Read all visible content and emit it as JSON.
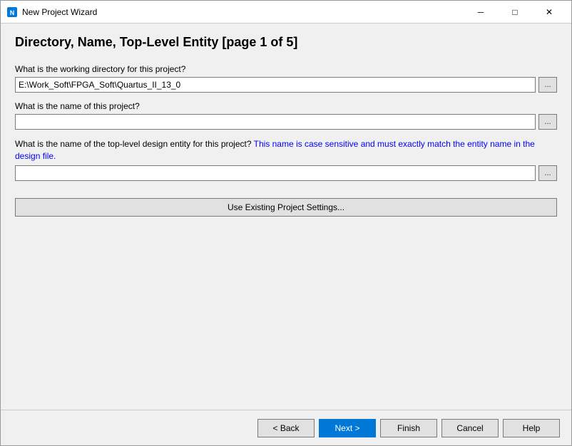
{
  "window": {
    "title": "New Project Wizard",
    "close_btn": "✕",
    "minimize_btn": "─",
    "maximize_btn": "□"
  },
  "page": {
    "title": "Directory, Name, Top-Level Entity [page 1 of 5]"
  },
  "form": {
    "working_dir_label": "What is the working directory for this project?",
    "working_dir_value": "E:\\Work_Soft\\FPGA_Soft\\Quartus_II_13_0",
    "working_dir_browse": "...",
    "project_name_label": "What is the name of this project?",
    "project_name_value": "",
    "project_name_browse": "...",
    "top_level_label_part1": "What is the name of the top-level design entity for this project?",
    "top_level_label_part2": " This name is case sensitive and must exactly match the entity name in the design file.",
    "top_level_value": "",
    "top_level_browse": "...",
    "use_existing_btn": "Use Existing Project Settings..."
  },
  "footer": {
    "back_btn": "< Back",
    "next_btn": "Next >",
    "finish_btn": "Finish",
    "cancel_btn": "Cancel",
    "help_btn": "Help"
  }
}
